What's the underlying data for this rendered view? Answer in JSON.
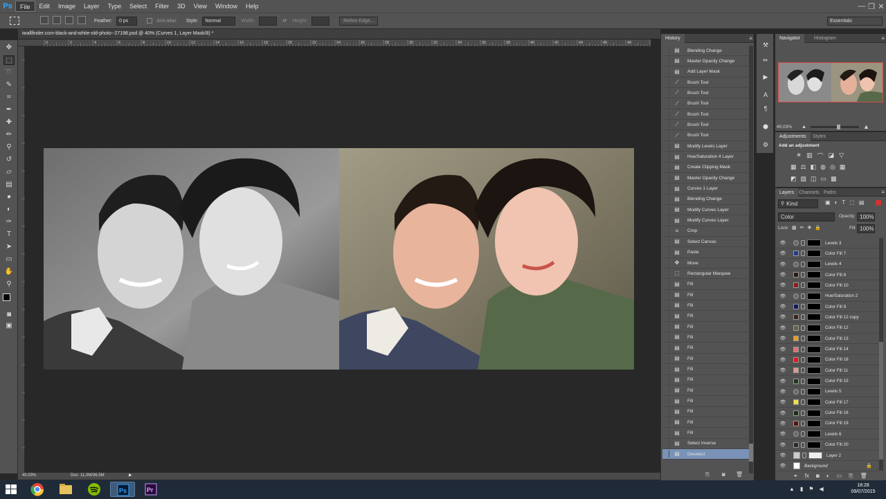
{
  "app": {
    "logo": "Ps"
  },
  "menu": [
    "File",
    "Edit",
    "Image",
    "Layer",
    "Type",
    "Select",
    "Filter",
    "3D",
    "View",
    "Window",
    "Help"
  ],
  "window_controls": {
    "minimize": "—",
    "restore": "❐",
    "close": "✕"
  },
  "options": {
    "feather_label": "Feather:",
    "feather_value": "0 px",
    "antialias_label": "Anti-alias",
    "style_label": "Style:",
    "style_value": "Normal",
    "width_label": "Width:",
    "height_label": "Height:",
    "refine_edge": "Refine Edge...",
    "workspace": "Essentials"
  },
  "document": {
    "tab_title": "iwallfinder.com-black-and-white-old-photo--27198.psd @ 40% (Curves 1, Layer Mask/8) *",
    "zoom": "40,03%",
    "doc_size": "Doc: 11,0M/36,5M"
  },
  "ruler": {
    "top": [
      "0",
      "2",
      "4",
      "6",
      "8",
      "10",
      "12",
      "14",
      "16",
      "18",
      "20",
      "22",
      "24",
      "26",
      "28",
      "30",
      "32",
      "34",
      "36",
      "38",
      "40",
      "42",
      "44",
      "46",
      "48",
      "50"
    ]
  },
  "history": {
    "tab": "History",
    "items": [
      {
        "label": "Blending Change",
        "icon": "doc"
      },
      {
        "label": "Master Opacity Change",
        "icon": "doc"
      },
      {
        "label": "Add Layer Mask",
        "icon": "doc"
      },
      {
        "label": "Brush Tool",
        "icon": "brush"
      },
      {
        "label": "Brush Tool",
        "icon": "brush"
      },
      {
        "label": "Brush Tool",
        "icon": "brush"
      },
      {
        "label": "Brush Tool",
        "icon": "brush"
      },
      {
        "label": "Brush Tool",
        "icon": "brush"
      },
      {
        "label": "Brush Tool",
        "icon": "brush"
      },
      {
        "label": "Modify Levels Layer",
        "icon": "doc"
      },
      {
        "label": "Hue/Saturation 4 Layer",
        "icon": "doc"
      },
      {
        "label": "Create Clipping Mask",
        "icon": "doc"
      },
      {
        "label": "Master Opacity Change",
        "icon": "doc"
      },
      {
        "label": "Curves 1 Layer",
        "icon": "doc"
      },
      {
        "label": "Blending Change",
        "icon": "doc"
      },
      {
        "label": "Modify Curves Layer",
        "icon": "doc"
      },
      {
        "label": "Modify Curves Layer",
        "icon": "doc"
      },
      {
        "label": "Crop",
        "icon": "crop"
      },
      {
        "label": "Select Canvas",
        "icon": "doc"
      },
      {
        "label": "Paste",
        "icon": "doc"
      },
      {
        "label": "Move",
        "icon": "move"
      },
      {
        "label": "Rectangular Marquee",
        "icon": "marquee"
      },
      {
        "label": "Fill",
        "icon": "doc"
      },
      {
        "label": "Fill",
        "icon": "doc"
      },
      {
        "label": "Fill",
        "icon": "doc"
      },
      {
        "label": "Fill",
        "icon": "doc"
      },
      {
        "label": "Fill",
        "icon": "doc"
      },
      {
        "label": "Fill",
        "icon": "doc"
      },
      {
        "label": "Fill",
        "icon": "doc"
      },
      {
        "label": "Fill",
        "icon": "doc"
      },
      {
        "label": "Fill",
        "icon": "doc"
      },
      {
        "label": "Fill",
        "icon": "doc"
      },
      {
        "label": "Fill",
        "icon": "doc"
      },
      {
        "label": "Fill",
        "icon": "doc"
      },
      {
        "label": "Fill",
        "icon": "doc"
      },
      {
        "label": "Fill",
        "icon": "doc"
      },
      {
        "label": "Fill",
        "icon": "doc"
      },
      {
        "label": "Select Inverse",
        "icon": "doc"
      },
      {
        "label": "Deselect",
        "icon": "doc",
        "selected": true
      }
    ]
  },
  "navigator": {
    "tabs": [
      "Navigator",
      "Histogram"
    ],
    "zoom": "40,03%"
  },
  "adjustments": {
    "tabs": [
      "Adjustments",
      "Styles"
    ],
    "heading": "Add an adjustment"
  },
  "layers": {
    "tabs": [
      "Layers",
      "Channels",
      "Paths"
    ],
    "filter": "Kind",
    "blend_mode": "Color",
    "opacity_label": "Opacity:",
    "opacity": "100%",
    "lock_label": "Lock:",
    "fill_label": "Fill:",
    "fill": "100%",
    "items": [
      {
        "name": "Levels 3",
        "color": "#6a6a6a",
        "type": "adj"
      },
      {
        "name": "Color Fill 7",
        "color": "#1e3d8c",
        "type": "fill"
      },
      {
        "name": "Levels 4",
        "color": "#6a6a6a",
        "type": "adj"
      },
      {
        "name": "Color Fill 8",
        "color": "#2a1a14",
        "type": "fill"
      },
      {
        "name": "Color Fill 10",
        "color": "#8c1a1a",
        "type": "fill"
      },
      {
        "name": "Hue/Saturation 2",
        "color": "#6a6a6a",
        "type": "adj"
      },
      {
        "name": "Color Fill 9",
        "color": "#0e1a5a",
        "type": "fill"
      },
      {
        "name": "Color Fill 12 copy",
        "color": "#3a2418",
        "type": "fill"
      },
      {
        "name": "Color Fill 12",
        "color": "#6a6248",
        "type": "fill"
      },
      {
        "name": "Color Fill 13",
        "color": "#e6a020",
        "type": "fill"
      },
      {
        "name": "Color Fill 14",
        "color": "#e07070",
        "type": "fill"
      },
      {
        "name": "Color Fill 18",
        "color": "#e01818",
        "type": "fill"
      },
      {
        "name": "Color Fill 11",
        "color": "#d89a8c",
        "type": "fill"
      },
      {
        "name": "Color Fill 15",
        "color": "#1e3a1a",
        "type": "fill"
      },
      {
        "name": "Levels 5",
        "color": "#6a6a6a",
        "type": "adj"
      },
      {
        "name": "Color Fill 17",
        "color": "#f0e040",
        "type": "fill"
      },
      {
        "name": "Color Fill 16",
        "color": "#1a3010",
        "type": "fill"
      },
      {
        "name": "Color Fill 19",
        "color": "#5a1010",
        "type": "fill"
      },
      {
        "name": "Levels 6",
        "color": "#6a6a6a",
        "type": "adj"
      },
      {
        "name": "Color Fill 20",
        "color": "#2a2a2a",
        "type": "fill"
      },
      {
        "name": "Layer 2",
        "color": "#cccccc",
        "type": "layer"
      },
      {
        "name": "Background",
        "color": "#ffffff",
        "type": "bg"
      }
    ]
  },
  "taskbar": {
    "time": "18:28",
    "date": "09/07/2015"
  }
}
